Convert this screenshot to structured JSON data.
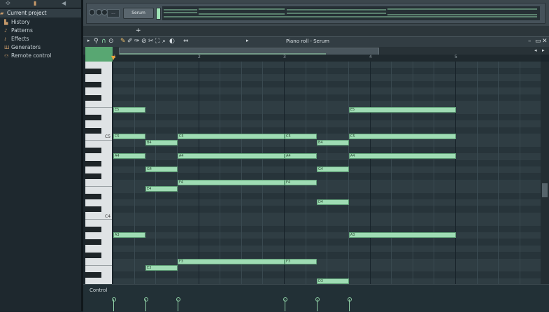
{
  "browser": {
    "items": [
      {
        "label": "Current project",
        "icon": "folder-icon"
      },
      {
        "label": "History",
        "icon": "history-icon"
      },
      {
        "label": "Patterns",
        "icon": "pattern-icon"
      },
      {
        "label": "Effects",
        "icon": "effects-icon"
      },
      {
        "label": "Generators",
        "icon": "generators-icon"
      },
      {
        "label": "Remote control",
        "icon": "remote-icon"
      }
    ]
  },
  "channel_rack": {
    "dots_label": "...",
    "channel_name": "Serum",
    "add_label": "+"
  },
  "piano_roll": {
    "title": "Piano roll - Serum",
    "bars": [
      "1",
      "2",
      "3",
      "4",
      "5"
    ],
    "key_labels": {
      "c5": "C5",
      "c4": "C4"
    },
    "control_label": "Control"
  },
  "notes": [
    {
      "pitch": "E5",
      "label": "E5",
      "start": 1.0,
      "len": 0.375
    },
    {
      "pitch": "C5",
      "label": "C5",
      "start": 1.0,
      "len": 0.375
    },
    {
      "pitch": "A4",
      "label": "A4",
      "start": 1.0,
      "len": 0.375
    },
    {
      "pitch": "A3",
      "label": "A3",
      "start": 1.0,
      "len": 0.375
    },
    {
      "pitch": "B4",
      "label": "B4",
      "start": 1.375,
      "len": 0.375
    },
    {
      "pitch": "G4",
      "label": "G4",
      "start": 1.375,
      "len": 0.375
    },
    {
      "pitch": "E4",
      "label": "E4",
      "start": 1.375,
      "len": 0.375
    },
    {
      "pitch": "E3",
      "label": "E3",
      "start": 1.375,
      "len": 0.375
    },
    {
      "pitch": "C5",
      "label": "C5",
      "start": 1.75,
      "len": 1.25
    },
    {
      "pitch": "A4",
      "label": "A4",
      "start": 1.75,
      "len": 1.25
    },
    {
      "pitch": "F4",
      "label": "F4",
      "start": 1.75,
      "len": 1.25
    },
    {
      "pitch": "F3",
      "label": "F3",
      "start": 1.75,
      "len": 1.25
    },
    {
      "pitch": "C5",
      "label": "C5",
      "start": 3.0,
      "len": 0.375
    },
    {
      "pitch": "A4",
      "label": "A4",
      "start": 3.0,
      "len": 0.375
    },
    {
      "pitch": "F4",
      "label": "F4",
      "start": 3.0,
      "len": 0.375
    },
    {
      "pitch": "F3",
      "label": "F3",
      "start": 3.0,
      "len": 0.375
    },
    {
      "pitch": "B4",
      "label": "B4",
      "start": 3.375,
      "len": 0.375
    },
    {
      "pitch": "G4",
      "label": "G4",
      "start": 3.375,
      "len": 0.375
    },
    {
      "pitch": "D4",
      "label": "D4",
      "start": 3.375,
      "len": 0.375
    },
    {
      "pitch": "D3",
      "label": "D3",
      "start": 3.375,
      "len": 0.375
    },
    {
      "pitch": "E5",
      "label": "E5",
      "start": 3.75,
      "len": 1.25
    },
    {
      "pitch": "C5",
      "label": "C5",
      "start": 3.75,
      "len": 1.25
    },
    {
      "pitch": "A4",
      "label": "A4",
      "start": 3.75,
      "len": 1.25
    },
    {
      "pitch": "A3",
      "label": "A3",
      "start": 3.75,
      "len": 1.25
    }
  ]
}
